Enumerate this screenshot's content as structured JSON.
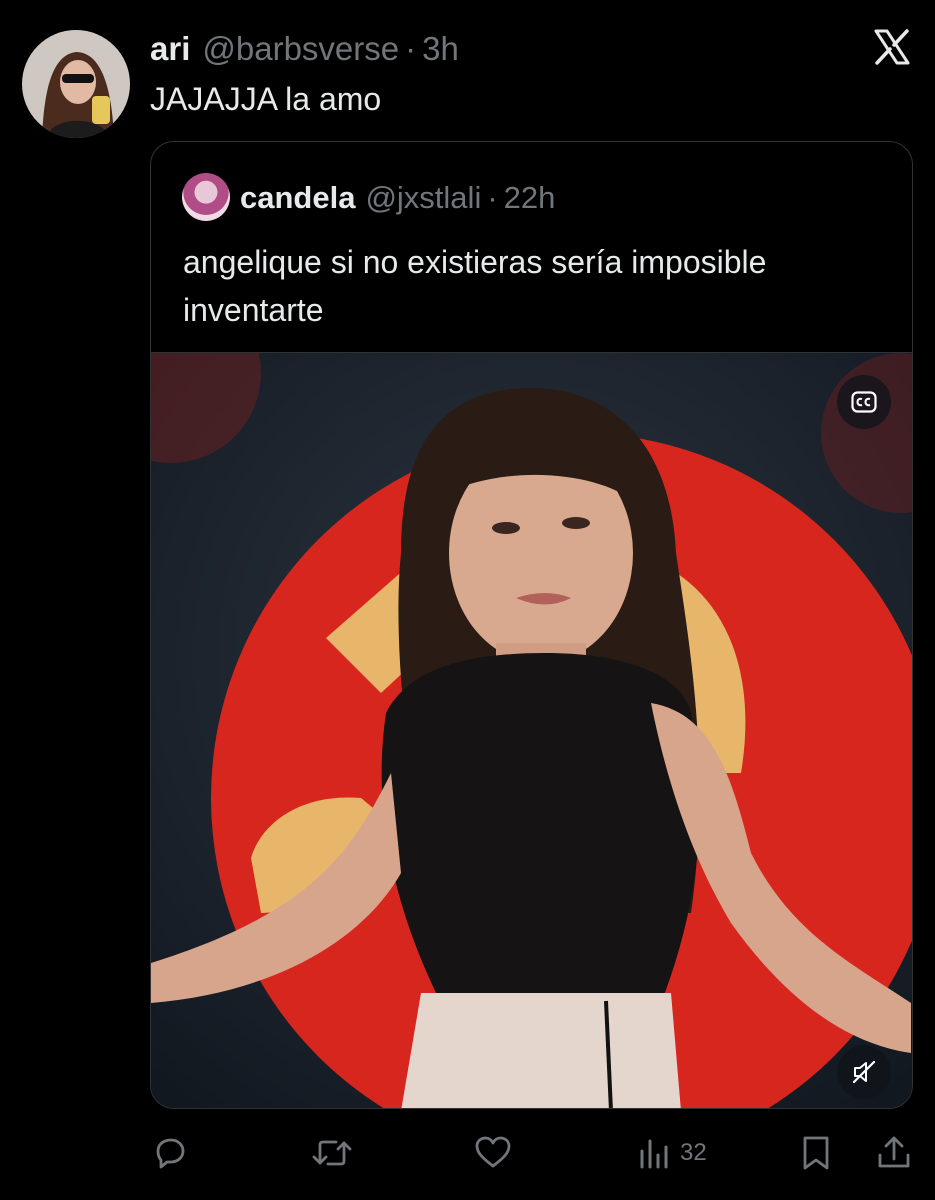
{
  "tweet": {
    "author_name": "ari",
    "handle": "@barbsverse",
    "separator": "·",
    "time": "3h",
    "text": "JAJAJJA la amo"
  },
  "quoted_tweet": {
    "author_name": "candela",
    "handle": "@jxstlali",
    "separator": "·",
    "time": "22h",
    "text": "angelique si no existieras sería imposible inventarte"
  },
  "media": {
    "captions_icon": "cc-icon",
    "mute_icon": "speaker-muted-icon"
  },
  "actions": {
    "reply_icon": "reply-icon",
    "retweet_icon": "retweet-icon",
    "like_icon": "heart-icon",
    "views_icon": "views-icon",
    "views_count": "32",
    "bookmark_icon": "bookmark-icon",
    "share_icon": "share-icon"
  },
  "colors": {
    "background": "#000000",
    "text_primary": "#e7e9ea",
    "text_muted": "#71767b",
    "border": "#2f3336"
  }
}
